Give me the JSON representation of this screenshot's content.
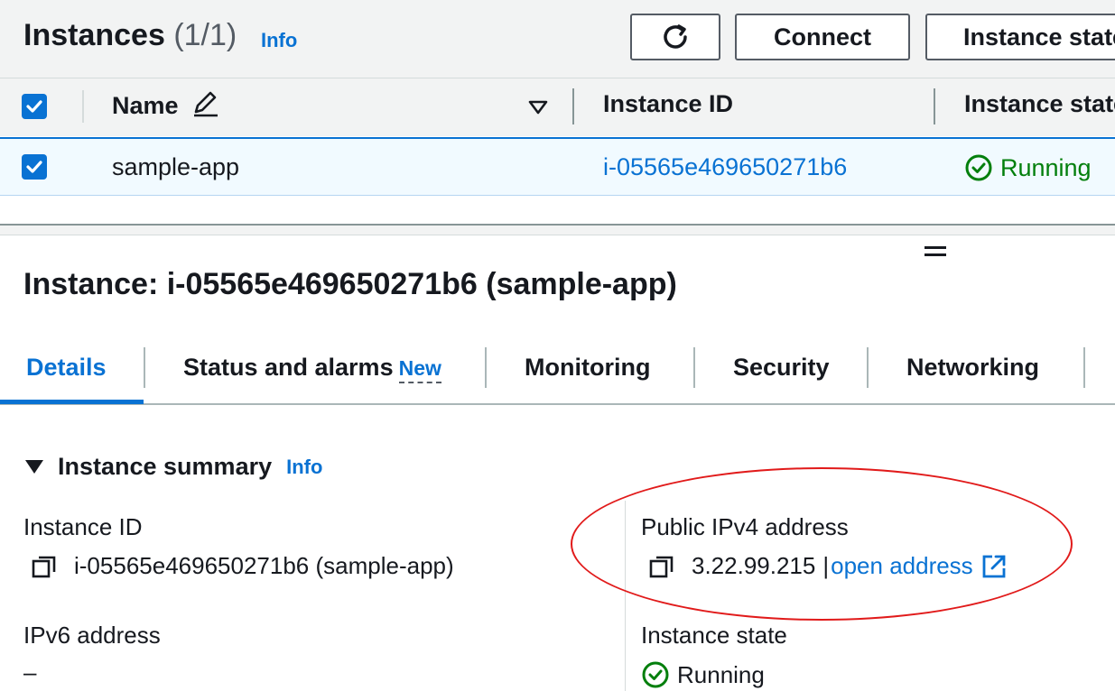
{
  "header": {
    "title": "Instances",
    "count": "(1/1)",
    "info": "Info",
    "connect_label": "Connect",
    "instance_state_label": "Instance state"
  },
  "table": {
    "columns": [
      "Name",
      "Instance ID",
      "Instance state"
    ],
    "rows": [
      {
        "name": "sample-app",
        "instance_id": "i-05565e469650271b6",
        "state": "Running"
      }
    ]
  },
  "detail": {
    "title": "Instance: i-05565e469650271b6 (sample-app)",
    "tabs": [
      "Details",
      "Status and alarms",
      "Monitoring",
      "Security",
      "Networking"
    ],
    "new_badge": "New",
    "section_title": "Instance summary",
    "section_info": "Info",
    "fields": {
      "instance_id_label": "Instance ID",
      "instance_id_value": "i-05565e469650271b6 (sample-app)",
      "public_ipv4_label": "Public IPv4 address",
      "public_ipv4_value": "3.22.99.215",
      "open_address": "open address",
      "ipv6_label": "IPv6 address",
      "ipv6_value": "–",
      "instance_state_label": "Instance state",
      "instance_state_value": "Running"
    }
  },
  "colors": {
    "accent": "#0972d3",
    "running": "#037f0c",
    "annotation": "#e11a1a"
  },
  "icons": [
    "refresh-icon",
    "pencil-icon",
    "filter-caret-icon",
    "checkbox-check-icon",
    "status-running-icon",
    "copy-icon",
    "external-link-icon",
    "caret-down-icon",
    "drag-handle-icon"
  ]
}
